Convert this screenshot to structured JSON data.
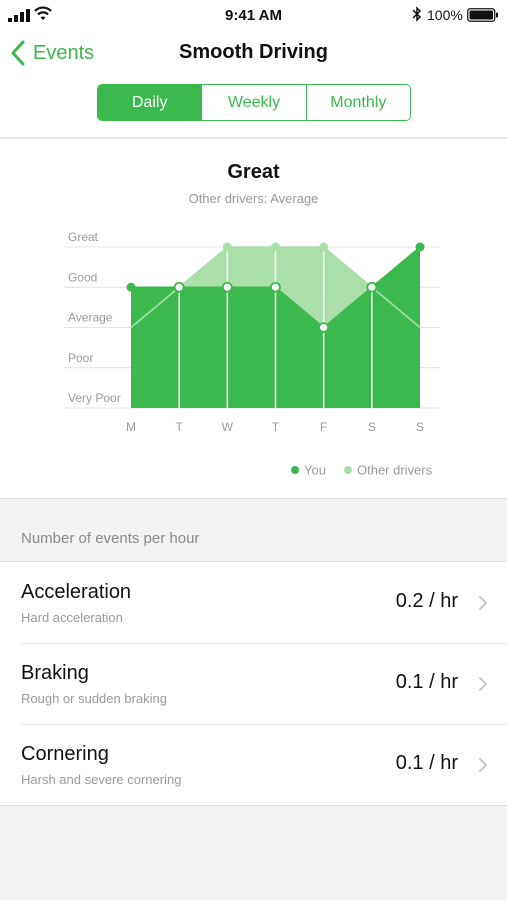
{
  "status_bar": {
    "time": "9:41 AM",
    "battery_percent": "100%",
    "icons": [
      "cellular-signal-icon",
      "wifi-icon",
      "bluetooth-icon",
      "battery-icon"
    ]
  },
  "nav": {
    "back_label": "Events",
    "title": "Smooth Driving"
  },
  "segments": {
    "items": [
      "Daily",
      "Weekly",
      "Monthly"
    ],
    "selected": "Daily"
  },
  "colors": {
    "accent": "#3cb94e",
    "other_drivers": "#abdfaa"
  },
  "chart": {
    "title": "Great",
    "subtitle": "Other drivers: Average"
  },
  "chart_data": {
    "type": "area",
    "categories": [
      "M",
      "T",
      "W",
      "T",
      "F",
      "S",
      "S"
    ],
    "y_levels": [
      "Very Poor",
      "Poor",
      "Average",
      "Good",
      "Great"
    ],
    "ylim": [
      0,
      4
    ],
    "series": [
      {
        "name": "You",
        "color": "#3cb94e",
        "values": [
          3,
          3,
          3,
          3,
          2,
          3,
          4
        ]
      },
      {
        "name": "Other drivers",
        "color": "#abdfaa",
        "values": [
          2,
          3,
          4,
          4,
          4,
          3,
          2
        ]
      }
    ],
    "grid": true,
    "legend_position": "bottom-right"
  },
  "events": {
    "section_title": "Number of events per hour",
    "rows": [
      {
        "title": "Acceleration",
        "subtitle": "Hard acceleration",
        "value": "0.2 / hr"
      },
      {
        "title": "Braking",
        "subtitle": "Rough or sudden braking",
        "value": "0.1 / hr"
      },
      {
        "title": "Cornering",
        "subtitle": "Harsh and severe cornering",
        "value": "0.1 / hr"
      }
    ]
  }
}
